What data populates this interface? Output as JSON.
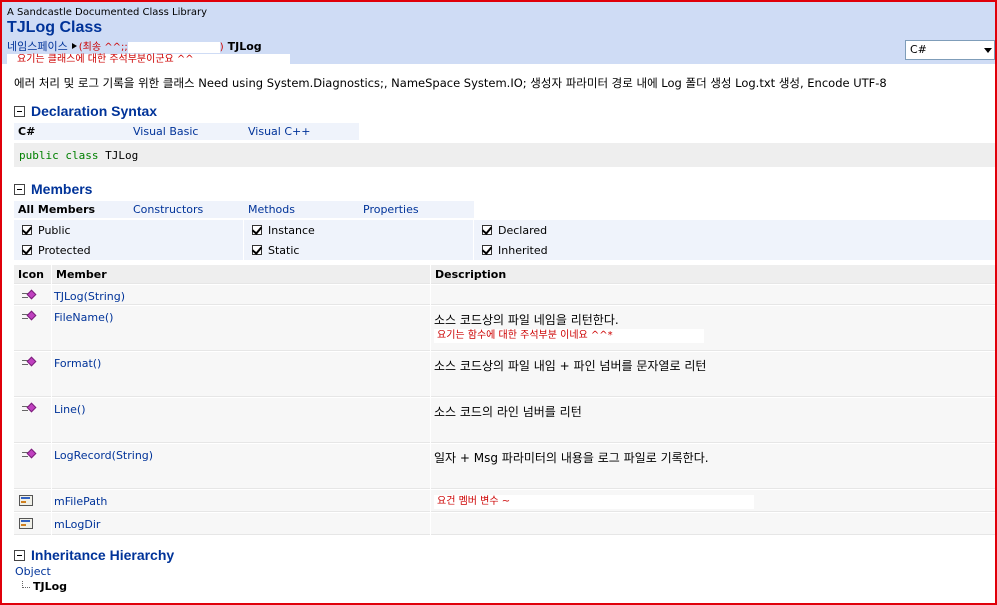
{
  "header": {
    "library": "A Sandcastle Documented Class Library",
    "title": "TJLog Class",
    "namespace_label": "네임스페이스",
    "namespace_note": "(최송 ^^;;",
    "namespace_close": ")",
    "class_name": "TJLog",
    "class_note": "요기는 클래스에 대한 주석부분이군요 ^^",
    "language": "C#"
  },
  "summary": "에러 처리 및 로그 기록을 위한 클래스 Need using System.Diagnostics;, NameSpace System.IO; 생성자 파라미터 경로 내에 Log 폴더 생성 Log.txt 생성, Encode UTF-8",
  "declaration": {
    "title": "Declaration Syntax",
    "tabs": [
      "C#",
      "Visual Basic",
      "Visual C++"
    ],
    "code_kw": "public class",
    "code_name": "TJLog"
  },
  "members": {
    "title": "Members",
    "tabs": [
      "All Members",
      "Constructors",
      "Methods",
      "Properties"
    ],
    "filters": [
      "Public",
      "Protected",
      "Instance",
      "Static",
      "Declared",
      "Inherited"
    ],
    "columns": [
      "Icon",
      "Member",
      "Description"
    ],
    "rows": [
      {
        "icon": "method-icon",
        "member": "TJLog(String)",
        "desc": ""
      },
      {
        "icon": "method-icon",
        "member": "FileName()",
        "desc": "소스 코드상의 파일 네임을 리턴한다.",
        "note": "요기는 함수에 대한 주석부분 이네요 ^^*"
      },
      {
        "icon": "method-icon",
        "member": "Format()",
        "desc": "소스 코드상의 파일 내임 + 파인 넘버를 문자열로 리턴"
      },
      {
        "icon": "method-icon",
        "member": "Line()",
        "desc": "소스 코드의 라인 넘버를 리턴"
      },
      {
        "icon": "method-icon",
        "member": "LogRecord(String)",
        "desc": "일자 + Msg 파라미터의 내용을 로그 파일로 기록한다."
      },
      {
        "icon": "field-icon",
        "member": "mFilePath",
        "desc": "",
        "note": "요건 멤버 변수 ~"
      },
      {
        "icon": "field-icon",
        "member": "mLogDir",
        "desc": ""
      }
    ]
  },
  "inheritance": {
    "title": "Inheritance Hierarchy",
    "root": "Object",
    "child": "TJLog"
  }
}
